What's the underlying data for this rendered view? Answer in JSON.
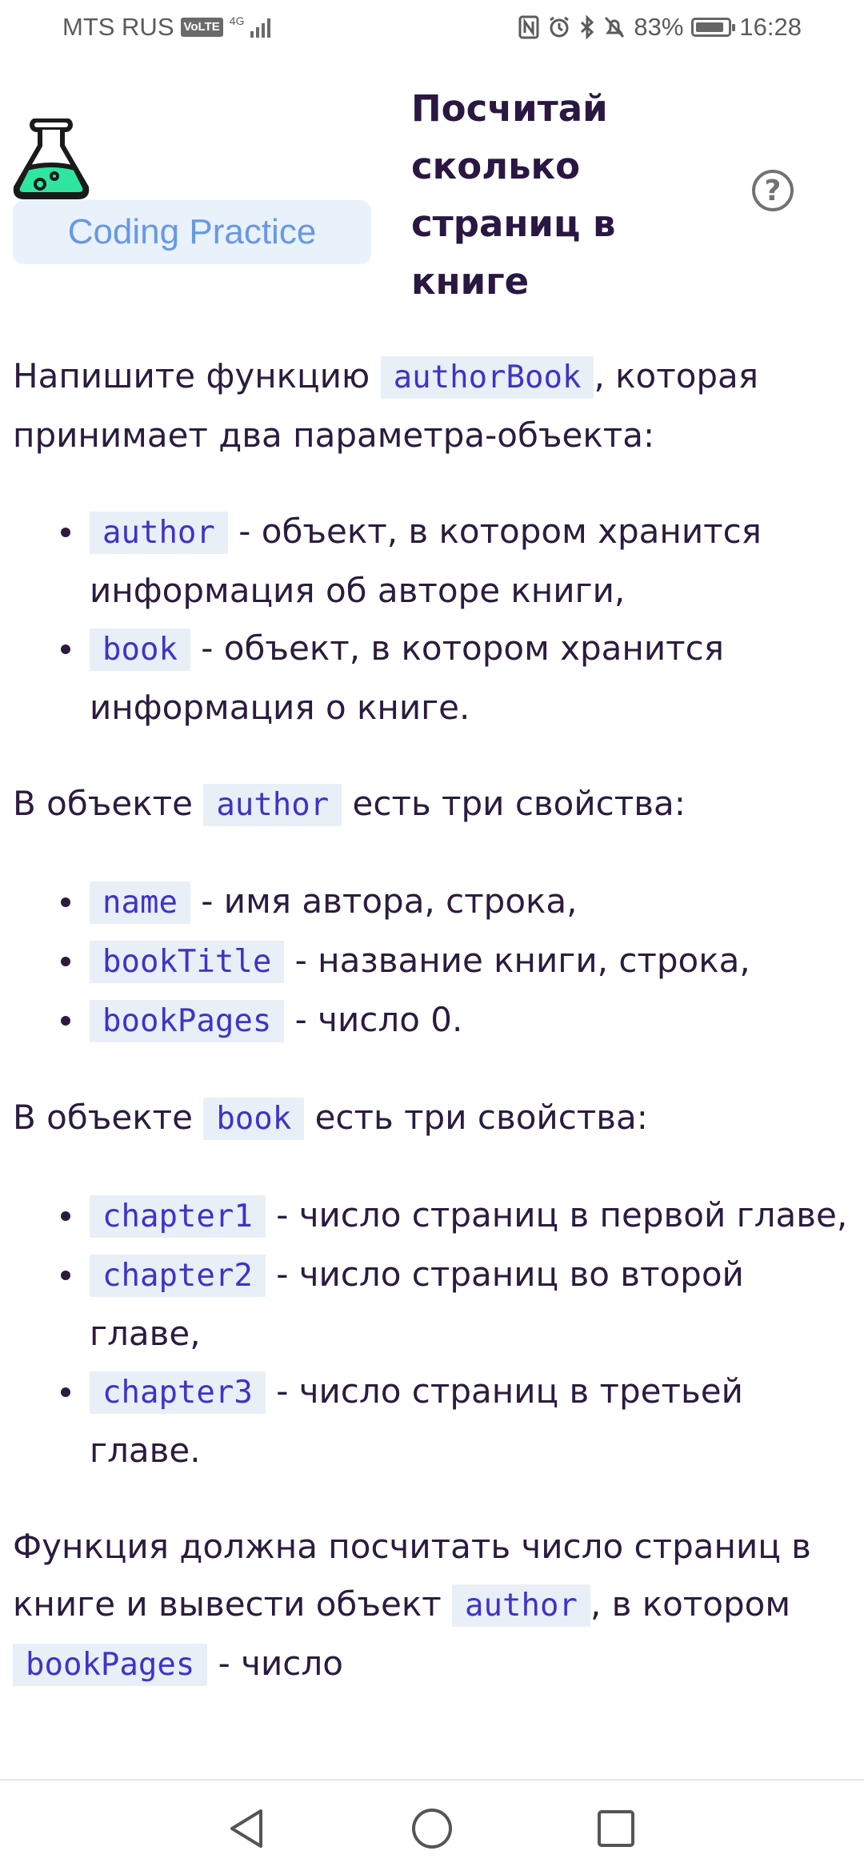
{
  "status_bar": {
    "carrier": "MTS RUS",
    "volte": "VoLTE",
    "network": "4G",
    "battery": "83%",
    "time": "16:28"
  },
  "header": {
    "badge": "Coding Practice",
    "title": "Посчитай сколько страниц в книге",
    "help": "?"
  },
  "content": {
    "p1_before": "Напишите функцию",
    "p1_code": "authorBook",
    "p1_after": ", которая принимает два параметра-объекта:",
    "params": [
      {
        "code": "author",
        "text": " - объект, в котором хранится информация об авторе книги,"
      },
      {
        "code": "book",
        "text": " - объект, в котором хранится информация о книге."
      }
    ],
    "p2_before": "В объекте",
    "p2_code": "author",
    "p2_after": " есть три свойства:",
    "author_props": [
      {
        "code": "name",
        "text": " - имя автора, строка,"
      },
      {
        "code": "bookTitle",
        "text": " - название книги, строка,"
      },
      {
        "code": "bookPages",
        "text": " - число 0."
      }
    ],
    "p3_before": "В объекте",
    "p3_code": "book",
    "p3_after": " есть три свойства:",
    "book_props": [
      {
        "code": "chapter1",
        "text": " - число страниц в первой главе,"
      },
      {
        "code": "chapter2",
        "text": " - число страниц во второй главе,"
      },
      {
        "code": "chapter3",
        "text": " - число страниц в третьей главе."
      }
    ],
    "p4_text": "Функция должна посчитать число страниц в книге и вывести объект",
    "p4_code1": "author",
    "p4_mid": ", в котором",
    "p4_code2": "bookPages",
    "p4_end": " - число"
  },
  "colors": {
    "text": "#2b1c3f",
    "code_text": "#3e33c9",
    "code_bg": "#e9eff6",
    "badge_bg": "#e9f1fb",
    "badge_text": "#6699e3",
    "flask_liquid": "#2ee6a0"
  }
}
